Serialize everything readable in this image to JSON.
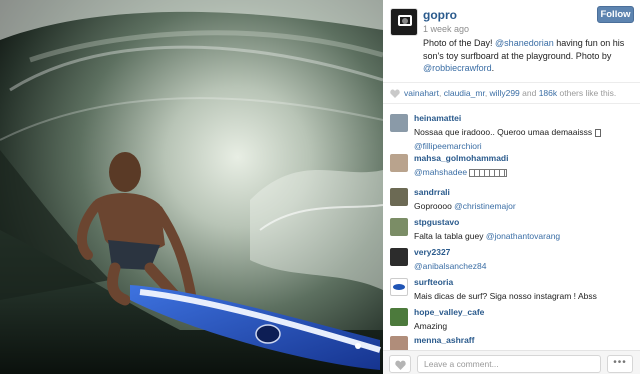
{
  "post": {
    "username": "gopro",
    "time_ago": "1 week ago",
    "follow_label": "Follow",
    "caption_parts": {
      "c1": "Photo of the Day! ",
      "m1": "@shanedorian",
      "c2": " having fun on his son's toy surfboard at the playground. Photo by ",
      "m2": "@robbiecrawford",
      "c3": "."
    }
  },
  "likes": {
    "users": [
      "vainahart",
      "claudia_mr",
      "willy299"
    ],
    "count_text": "186k",
    "suffix": " others like this."
  },
  "comments": [
    {
      "user": "heinamattei",
      "text": "Nossaa que iradooo.. Queroo umaa demaaisss ",
      "mention": "@fillipeemarchiori",
      "avatar_color": "#8a9aa8"
    },
    {
      "user": "mahsa_golmohammadi",
      "text": "",
      "mention": "@mahshadee",
      "tail": " ",
      "avatar_color": "#b9a38d"
    },
    {
      "user": "sandrrali",
      "text": "Goproooo ",
      "mention": "@christinemajor",
      "avatar_color": "#6c6a54"
    },
    {
      "user": "stpgustavo",
      "text": "Falta la tabla guey ",
      "mention": "@jonathantovarang",
      "avatar_color": "#7b8d66"
    },
    {
      "user": "very2327",
      "text": "",
      "mention": "@anibalsanchez84",
      "avatar_color": "#2c2c2c"
    },
    {
      "user": "surfteoria",
      "text": "Mais dicas de surf? Siga nosso instagram ! Abss",
      "mention": "",
      "avatar_color": "#ffffff"
    },
    {
      "user": "hope_valley_cafe",
      "text": "Amazing",
      "mention": "",
      "avatar_color": "#4c7a3c"
    },
    {
      "user": "menna_ashraff",
      "text": "",
      "mention": "",
      "avatar_color": "#b08d7a"
    }
  ],
  "footer": {
    "comment_placeholder": "Leave a comment...",
    "more_label": "•••"
  },
  "icons": {
    "like": "heart-icon",
    "more": "ellipsis-icon",
    "logo": "gopro-camera-icon"
  },
  "colors": {
    "link": "#3b6ea5",
    "follow_bg": "#5d84b0",
    "surfboard": "#2a55c6"
  }
}
